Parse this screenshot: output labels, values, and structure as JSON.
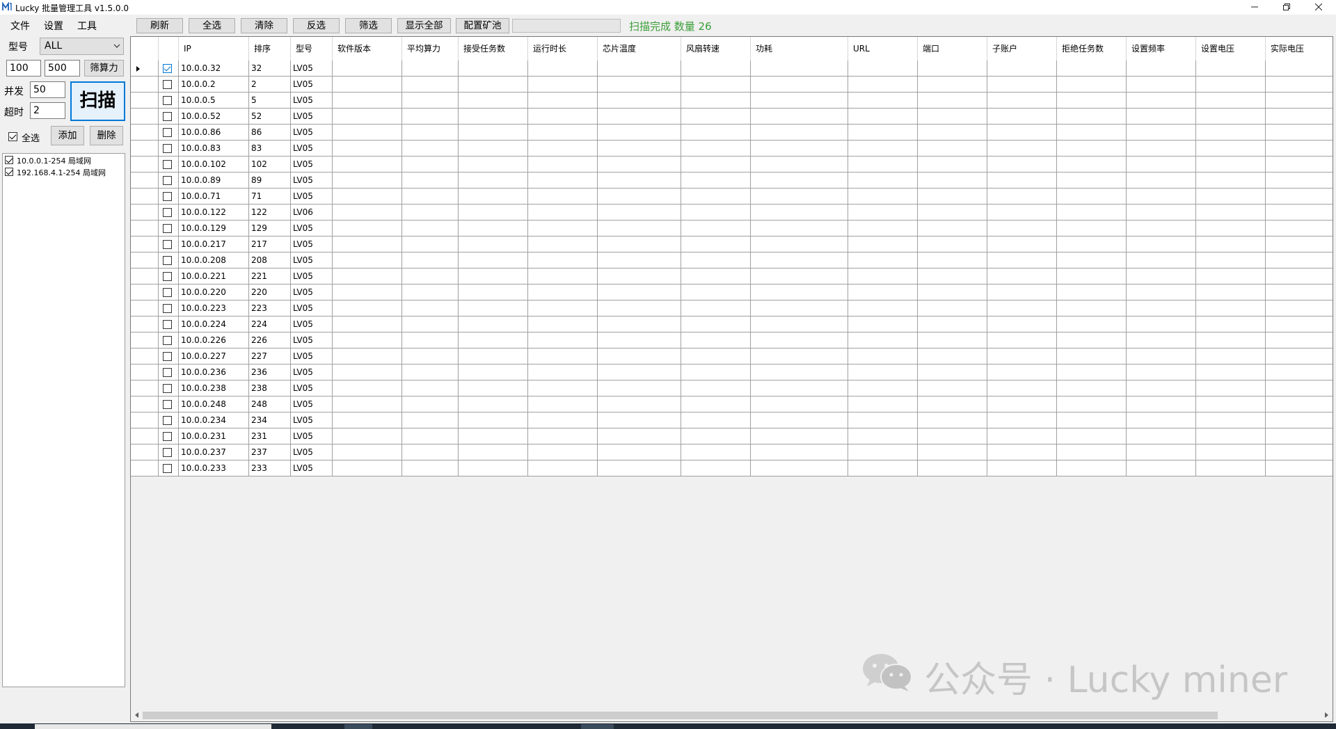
{
  "window": {
    "title": "Lucky 批量管理工具 v1.5.0.0"
  },
  "menu": {
    "items": [
      "文件",
      "设置",
      "工具"
    ]
  },
  "toolbar": {
    "buttons": [
      "刷新",
      "全选",
      "清除",
      "反选",
      "筛选",
      "显示全部",
      "配置矿池"
    ],
    "status": "扫描完成 数量  26",
    "status_color": "#3a9e37"
  },
  "left_panel": {
    "model_label": "型号",
    "model_value": "ALL",
    "hash_min": "100",
    "hash_max": "500",
    "filter_hash_button": "筛算力",
    "concurrency_label": "并发",
    "concurrency_value": "50",
    "timeout_label": "超时",
    "timeout_value": "2",
    "scan_button": "扫描",
    "select_all_label": "全选",
    "select_all_checked": true,
    "add_button": "添加",
    "delete_button": "删除",
    "networks": [
      {
        "label": "10.0.0.1-254 局域网",
        "checked": true
      },
      {
        "label": "192.168.4.1-254 局域网",
        "checked": true
      }
    ]
  },
  "grid": {
    "columns": [
      "IP",
      "排序",
      "型号",
      "软件版本",
      "平均算力",
      "接受任务数",
      "运行时长",
      "芯片温度",
      "风扇转速",
      "功耗",
      "URL",
      "端口",
      "子账户",
      "拒绝任务数",
      "设置频率",
      "设置电压",
      "实际电压"
    ],
    "rows": [
      {
        "checked": true,
        "ip": "10.0.0.32",
        "order": "32",
        "model": "LV05"
      },
      {
        "checked": false,
        "ip": "10.0.0.2",
        "order": "2",
        "model": "LV05"
      },
      {
        "checked": false,
        "ip": "10.0.0.5",
        "order": "5",
        "model": "LV05"
      },
      {
        "checked": false,
        "ip": "10.0.0.52",
        "order": "52",
        "model": "LV05"
      },
      {
        "checked": false,
        "ip": "10.0.0.86",
        "order": "86",
        "model": "LV05"
      },
      {
        "checked": false,
        "ip": "10.0.0.83",
        "order": "83",
        "model": "LV05"
      },
      {
        "checked": false,
        "ip": "10.0.0.102",
        "order": "102",
        "model": "LV05"
      },
      {
        "checked": false,
        "ip": "10.0.0.89",
        "order": "89",
        "model": "LV05"
      },
      {
        "checked": false,
        "ip": "10.0.0.71",
        "order": "71",
        "model": "LV05"
      },
      {
        "checked": false,
        "ip": "10.0.0.122",
        "order": "122",
        "model": "LV06"
      },
      {
        "checked": false,
        "ip": "10.0.0.129",
        "order": "129",
        "model": "LV05"
      },
      {
        "checked": false,
        "ip": "10.0.0.217",
        "order": "217",
        "model": "LV05"
      },
      {
        "checked": false,
        "ip": "10.0.0.208",
        "order": "208",
        "model": "LV05"
      },
      {
        "checked": false,
        "ip": "10.0.0.221",
        "order": "221",
        "model": "LV05"
      },
      {
        "checked": false,
        "ip": "10.0.0.220",
        "order": "220",
        "model": "LV05"
      },
      {
        "checked": false,
        "ip": "10.0.0.223",
        "order": "223",
        "model": "LV05"
      },
      {
        "checked": false,
        "ip": "10.0.0.224",
        "order": "224",
        "model": "LV05"
      },
      {
        "checked": false,
        "ip": "10.0.0.226",
        "order": "226",
        "model": "LV05"
      },
      {
        "checked": false,
        "ip": "10.0.0.227",
        "order": "227",
        "model": "LV05"
      },
      {
        "checked": false,
        "ip": "10.0.0.236",
        "order": "236",
        "model": "LV05"
      },
      {
        "checked": false,
        "ip": "10.0.0.238",
        "order": "238",
        "model": "LV05"
      },
      {
        "checked": false,
        "ip": "10.0.0.248",
        "order": "248",
        "model": "LV05"
      },
      {
        "checked": false,
        "ip": "10.0.0.234",
        "order": "234",
        "model": "LV05"
      },
      {
        "checked": false,
        "ip": "10.0.0.231",
        "order": "231",
        "model": "LV05"
      },
      {
        "checked": false,
        "ip": "10.0.0.237",
        "order": "237",
        "model": "LV05"
      },
      {
        "checked": false,
        "ip": "10.0.0.233",
        "order": "233",
        "model": "LV05"
      }
    ]
  },
  "watermark": {
    "text": "公众号 · Lucky miner"
  },
  "icons": {
    "app": "app-logo-icon",
    "minimize": "minimize-icon",
    "restore": "restore-icon",
    "close": "close-icon",
    "dropdown": "chevron-down-icon",
    "row_pointer": "current-row-arrow-icon",
    "scroll_left": "scroll-left-icon",
    "scroll_right": "scroll-right-icon",
    "watermark": "wechat-icon"
  }
}
